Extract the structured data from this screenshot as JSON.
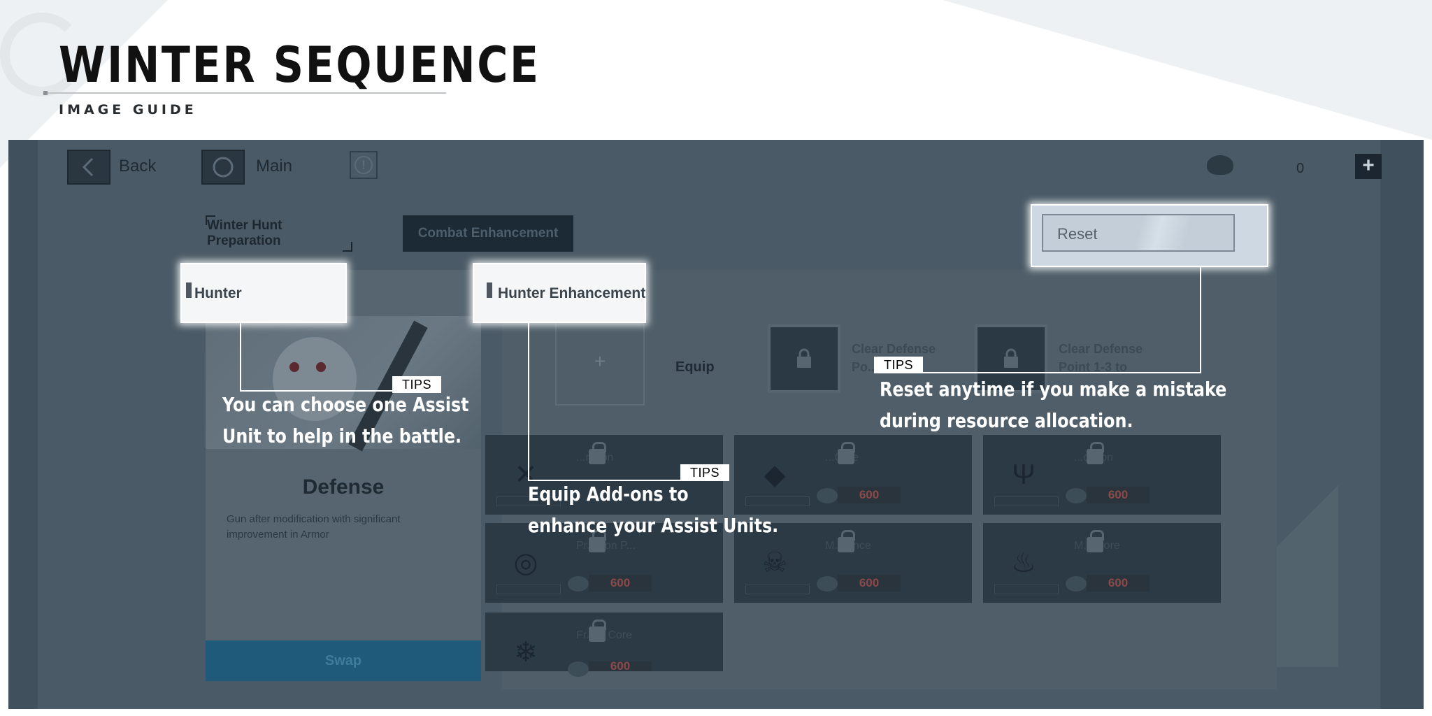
{
  "header": {
    "title": "WINTER SEQUENCE",
    "subtitle": "IMAGE GUIDE"
  },
  "game": {
    "nav": {
      "back_label": "Back",
      "main_label": "Main",
      "resource_count": "0"
    },
    "tabs": [
      {
        "label": "Winter Hunt Preparation",
        "active": false
      },
      {
        "label": "Combat Enhancement",
        "active": true
      }
    ],
    "hunter": {
      "section_label": "Hunter",
      "unit_name": "Defense",
      "description": "Gun after modification with significant improvement in Armor",
      "swap_label": "Swap"
    },
    "enhancement": {
      "section_label": "Hunter Enhancement",
      "equip_label": "Equip",
      "locked_slots": [
        {
          "text": "Clear Defense Po... unl..."
        },
        {
          "text": "Clear Defense Point 1-3 to"
        }
      ],
      "addon_cards": [
        {
          "name": "...ration",
          "icon": "blades-icon",
          "cost": ""
        },
        {
          "name": "...Core",
          "icon": "crystal-icon",
          "cost": "600"
        },
        {
          "name": "...cation",
          "icon": "trident-icon",
          "cost": "600"
        },
        {
          "name": "Pr... tion P...",
          "icon": "target-icon",
          "cost": "600"
        },
        {
          "name": "M... ance",
          "icon": "skull-icon",
          "cost": "600"
        },
        {
          "name": "M... Core",
          "icon": "flame-icon",
          "cost": "600"
        },
        {
          "name": "Fr... g Core",
          "icon": "snowflake-icon",
          "cost": "600"
        }
      ],
      "reset_label": "Reset"
    }
  },
  "tips": [
    {
      "tag": "TIPS",
      "line1": "You can choose one Assist",
      "line2": "Unit to help in the battle."
    },
    {
      "tag": "TIPS",
      "line1": "Equip Add-ons to",
      "line2": "enhance your Assist Units."
    },
    {
      "tag": "TIPS",
      "line1": "Reset anytime if you make a mistake",
      "line2": "during resource allocation."
    }
  ],
  "colors": {
    "overlay": "#4a5a66",
    "highlight": "#f5f6f8",
    "callout_line": "#ffffff",
    "cost_text": "#8a4a4a"
  }
}
